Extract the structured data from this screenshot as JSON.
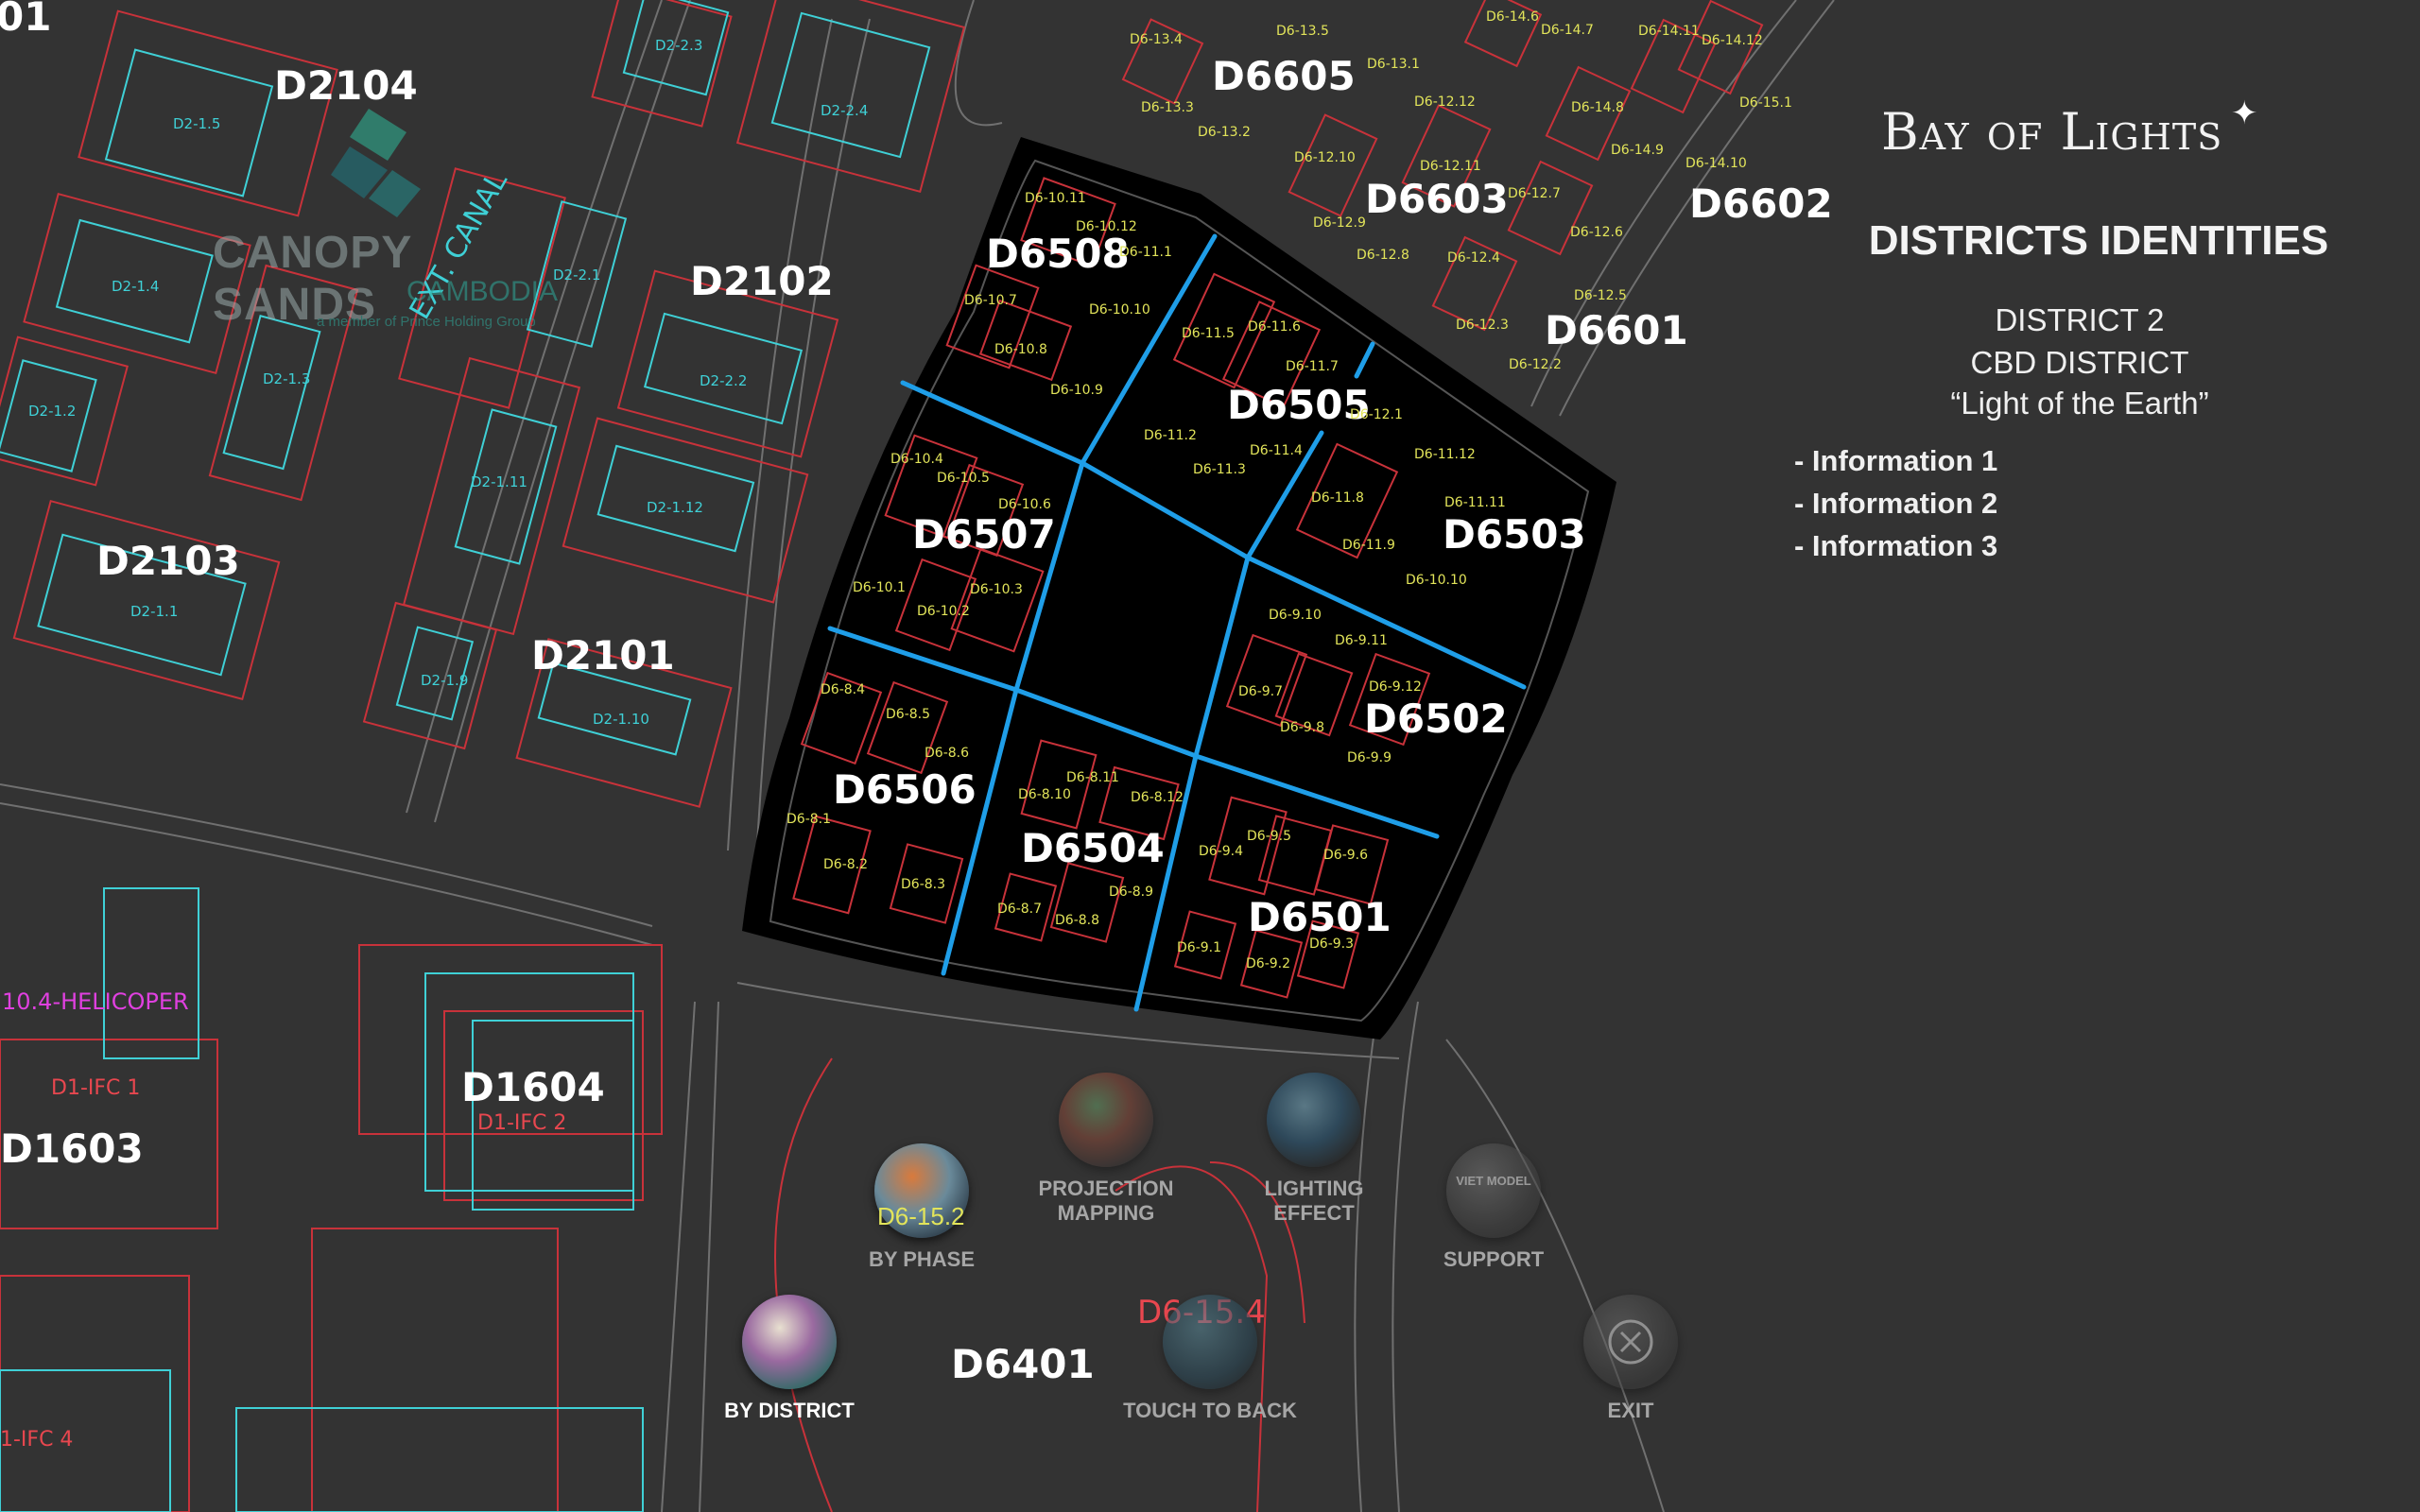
{
  "header": {
    "brand": "Bay of Lights",
    "brand_star": "✦",
    "title": "DISTRICTS IDENTITIES",
    "district": "DISTRICT 2",
    "district_type": "CBD DISTRICT",
    "district_motto": "“Light of the Earth”",
    "info_items": [
      "- Information 1",
      "- Information 2",
      "- Information 3"
    ]
  },
  "logo": {
    "name": "CANOPY SANDS",
    "country": "CAMBODIA",
    "tagline": "a member of Prince Holding Group"
  },
  "map": {
    "canal_label": "EXT. CANAL",
    "district_labels": [
      "D2104",
      "D2102",
      "D2103",
      "D2101",
      "D6605",
      "D6603",
      "D6602",
      "D6601",
      "D6508",
      "D6505",
      "D6507",
      "D6503",
      "D6502",
      "D6506",
      "D6504",
      "D6501",
      "D1604",
      "D1603",
      "D6401",
      "01"
    ],
    "red_labels": [
      "D1-IFC 1",
      "D1-IFC 2",
      "1-IFC 4",
      "D6-15.4"
    ],
    "magenta_labels": [
      "10.4-HELICOPER"
    ],
    "overlay_label": "D6-15.2",
    "cyan_plots": [
      "D2-1.5",
      "D2-2.3",
      "D2-2.4",
      "D2-1.4",
      "D2-2.1",
      "D2-1.3",
      "D2-2.2",
      "D2-1.2",
      "D2-1.11",
      "D2-1.12",
      "D2-1.1",
      "D2-1.9",
      "D2-1.10"
    ],
    "yellow_plots": [
      "D6-13.4",
      "D6-13.5",
      "D6-13.1",
      "D6-14.6",
      "D6-14.7",
      "D6-14.11",
      "D6-14.12",
      "D6-13.3",
      "D6-13.2",
      "D6-12.12",
      "D6-14.8",
      "D6-15.1",
      "D6-12.10",
      "D6-12.11",
      "D6-14.9",
      "D6-14.10",
      "D6-12.7",
      "D6-12.9",
      "D6-12.6",
      "D6-12.8",
      "D6-12.4",
      "D6-12.5",
      "D6-12.3",
      "D6-12.2",
      "D6-10.11",
      "D6-10.12",
      "D6-11.1",
      "D6-10.7",
      "D6-10.10",
      "D6-11.5",
      "D6-11.6",
      "D6-10.8",
      "D6-11.7",
      "D6-10.9",
      "D6-12.1",
      "D6-11.2",
      "D6-11.4",
      "D6-11.12",
      "D6-10.4",
      "D6-10.5",
      "D6-11.3",
      "D6-10.6",
      "D6-11.8",
      "D6-11.11",
      "D6-11.9",
      "D6-10.1",
      "D6-10.3",
      "D6-10.10",
      "D6-10.2",
      "D6-9.10",
      "D6-9.11",
      "D6-8.4",
      "D6-9.12",
      "D6-8.5",
      "D6-9.7",
      "D6-9.8",
      "D6-8.6",
      "D6-9.9",
      "D6-8.11",
      "D6-8.10",
      "D6-8.12",
      "D6-8.1",
      "D6-9.5",
      "D6-9.4",
      "D6-9.6",
      "D6-8.2",
      "D6-8.3",
      "D6-8.9",
      "D6-8.7",
      "D6-8.8",
      "D6-9.1",
      "D6-9.3",
      "D6-9.2"
    ]
  },
  "buttons": {
    "by_phase": "BY PHASE",
    "projection_mapping_line1": "PROJECTION",
    "projection_mapping_line2": "MAPPING",
    "lighting_effect_line1": "LIGHTING",
    "lighting_effect_line2": "EFFECT",
    "support": "SUPPORT",
    "support_logo": "VIET MODEL",
    "by_district": "BY DISTRICT",
    "touch_to_back": "TOUCH TO BACK",
    "exit": "EXIT"
  },
  "colors": {
    "background": "#333333",
    "highlight_area": "#000000",
    "road_blue": "#1f9ee8",
    "cyan": "#3fd0d6",
    "yellow": "#e2e45a",
    "red": "#e8474f",
    "magenta": "#e040e0"
  }
}
